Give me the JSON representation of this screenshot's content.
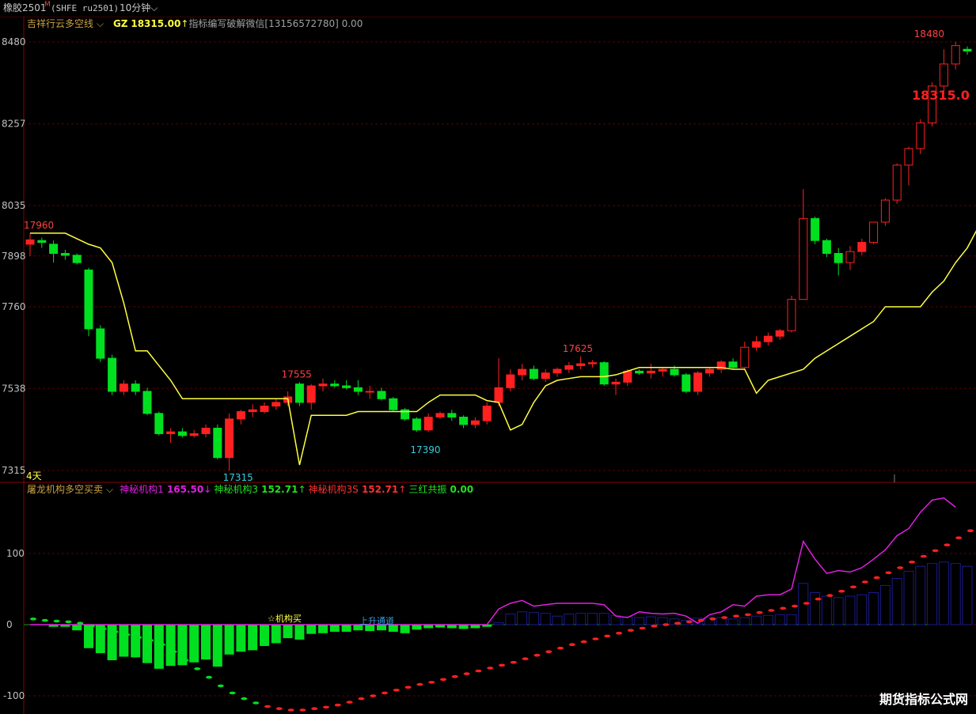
{
  "header": {
    "instrument": "橡胶2501",
    "superscript": "M",
    "code": "(SHFE ru2501)",
    "period": "10分钟"
  },
  "indicator1": {
    "name": "吉祥行云多空线",
    "gz_label": "GZ",
    "gz_value": "18315.00",
    "note": "指标编写破解微信[13156572780]",
    "note_value": "0.00"
  },
  "indicator2": {
    "name": "屠龙机构多空买卖",
    "items": [
      {
        "label": "神秘机构1",
        "value": "165.50",
        "arrow": "↓",
        "color": "#e020e0"
      },
      {
        "label": "神秘机构3",
        "value": "152.71",
        "arrow": "↑",
        "color": "#20e020"
      },
      {
        "label": "神秘机构3S",
        "value": "152.71",
        "arrow": "↑",
        "color": "#ff3030"
      },
      {
        "label": "三红共振",
        "value": "0.00",
        "arrow": "",
        "color": "#20e020"
      }
    ]
  },
  "annotations": {
    "days": "4天",
    "buy_signal": "☆机构买",
    "uptrend": "上升通道",
    "last_price": "18315.0"
  },
  "watermark": "期货指标公式网",
  "colors": {
    "up": "#ff2020",
    "down": "#00e020",
    "line": "#ffff40",
    "osc": "#e020e0",
    "bar_pos": "#1a1a8a",
    "grid": "#5a0000"
  },
  "chart_data": [
    {
      "type": "candlestick",
      "title": "吉祥行云多空线",
      "y_ticks": [
        {
          "label": "8480",
          "value": 18480
        },
        {
          "label": "8257",
          "value": 18257
        },
        {
          "label": "8035",
          "value": 18035
        },
        {
          "label": "7898",
          "value": 17898
        },
        {
          "label": "7760",
          "value": 17760
        },
        {
          "label": "7538",
          "value": 17538
        },
        {
          "label": "7315",
          "value": 17315
        }
      ],
      "ylim": [
        17315,
        18480
      ],
      "labels": [
        {
          "text": "17960",
          "i": 0,
          "value": 17960,
          "pos": "high"
        },
        {
          "text": "17555",
          "i": 22,
          "value": 17555,
          "pos": "high"
        },
        {
          "text": "17625",
          "i": 46,
          "value": 17625,
          "pos": "high"
        },
        {
          "text": "17315",
          "i": 17,
          "value": 17315,
          "pos": "low"
        },
        {
          "text": "17390",
          "i": 33,
          "value": 17390,
          "pos": "low"
        },
        {
          "text": "18480",
          "i": 76,
          "value": 18480,
          "pos": "high"
        }
      ],
      "ohlc": [
        [
          17930,
          17960,
          17898,
          17942
        ],
        [
          17940,
          17948,
          17920,
          17935
        ],
        [
          17930,
          17940,
          17880,
          17905
        ],
        [
          17905,
          17915,
          17888,
          17900
        ],
        [
          17900,
          17905,
          17875,
          17880
        ],
        [
          17860,
          17866,
          17680,
          17700
        ],
        [
          17700,
          17710,
          17610,
          17620
        ],
        [
          17620,
          17630,
          17520,
          17530
        ],
        [
          17530,
          17560,
          17520,
          17550
        ],
        [
          17550,
          17560,
          17520,
          17530
        ],
        [
          17530,
          17540,
          17465,
          17470
        ],
        [
          17470,
          17475,
          17410,
          17415
        ],
        [
          17415,
          17430,
          17390,
          17420
        ],
        [
          17420,
          17430,
          17405,
          17410
        ],
        [
          17410,
          17425,
          17405,
          17415
        ],
        [
          17415,
          17440,
          17405,
          17430
        ],
        [
          17430,
          17440,
          17345,
          17350
        ],
        [
          17350,
          17470,
          17315,
          17455
        ],
        [
          17455,
          17480,
          17440,
          17475
        ],
        [
          17475,
          17495,
          17460,
          17480
        ],
        [
          17475,
          17500,
          17470,
          17490
        ],
        [
          17490,
          17510,
          17480,
          17500
        ],
        [
          17500,
          17530,
          17490,
          17515
        ],
        [
          17550,
          17555,
          17490,
          17500
        ],
        [
          17500,
          17550,
          17480,
          17545
        ],
        [
          17545,
          17565,
          17530,
          17550
        ],
        [
          17550,
          17560,
          17540,
          17545
        ],
        [
          17545,
          17560,
          17535,
          17540
        ],
        [
          17540,
          17560,
          17520,
          17530
        ],
        [
          17530,
          17545,
          17510,
          17530
        ],
        [
          17530,
          17540,
          17505,
          17510
        ],
        [
          17510,
          17515,
          17475,
          17480
        ],
        [
          17480,
          17485,
          17450,
          17455
        ],
        [
          17455,
          17460,
          17420,
          17425
        ],
        [
          17425,
          17470,
          17420,
          17460
        ],
        [
          17460,
          17475,
          17455,
          17470
        ],
        [
          17470,
          17480,
          17450,
          17460
        ],
        [
          17460,
          17465,
          17430,
          17440
        ],
        [
          17440,
          17460,
          17430,
          17450
        ],
        [
          17450,
          17500,
          17440,
          17490
        ],
        [
          17500,
          17620,
          17490,
          17540
        ],
        [
          17540,
          17590,
          17530,
          17575
        ],
        [
          17575,
          17605,
          17560,
          17590
        ],
        [
          17590,
          17600,
          17560,
          17565
        ],
        [
          17565,
          17590,
          17555,
          17580
        ],
        [
          17580,
          17595,
          17570,
          17590
        ],
        [
          17590,
          17610,
          17580,
          17600
        ],
        [
          17600,
          17625,
          17590,
          17605
        ],
        [
          17605,
          17615,
          17595,
          17608
        ],
        [
          17608,
          17612,
          17545,
          17550
        ],
        [
          17550,
          17565,
          17520,
          17555
        ],
        [
          17555,
          17590,
          17545,
          17585
        ],
        [
          17585,
          17590,
          17575,
          17580
        ],
        [
          17580,
          17605,
          17565,
          17585
        ],
        [
          17585,
          17595,
          17570,
          17590
        ],
        [
          17590,
          17600,
          17570,
          17575
        ],
        [
          17575,
          17580,
          17525,
          17530
        ],
        [
          17530,
          17585,
          17520,
          17580
        ],
        [
          17580,
          17595,
          17570,
          17590
        ],
        [
          17590,
          17615,
          17580,
          17610
        ],
        [
          17610,
          17620,
          17590,
          17595
        ],
        [
          17595,
          17665,
          17590,
          17650
        ],
        [
          17650,
          17680,
          17640,
          17665
        ],
        [
          17665,
          17690,
          17655,
          17680
        ],
        [
          17680,
          17700,
          17670,
          17695
        ],
        [
          17695,
          17790,
          17690,
          17780
        ],
        [
          17780,
          18080,
          17780,
          18000
        ],
        [
          18000,
          18005,
          17930,
          17940
        ],
        [
          17940,
          17945,
          17895,
          17905
        ],
        [
          17905,
          17920,
          17845,
          17880
        ],
        [
          17880,
          17925,
          17860,
          17910
        ],
        [
          17910,
          17945,
          17900,
          17935
        ],
        [
          17935,
          17990,
          17930,
          17990
        ],
        [
          17990,
          18055,
          17980,
          18050
        ],
        [
          18050,
          18150,
          18040,
          18145
        ],
        [
          18145,
          18195,
          18090,
          18190
        ],
        [
          18190,
          18270,
          18175,
          18260
        ],
        [
          18260,
          18370,
          18250,
          18360
        ],
        [
          18360,
          18460,
          18340,
          18420
        ],
        [
          18420,
          18480,
          18405,
          18470
        ],
        [
          18460,
          18468,
          18445,
          18455
        ]
      ],
      "line": [
        17960,
        17960,
        17960,
        17960,
        17945,
        17930,
        17920,
        17880,
        17770,
        17640,
        17640,
        17600,
        17560,
        17510,
        17510,
        17510,
        17510,
        17510,
        17510,
        17510,
        17510,
        17510,
        17510,
        17330,
        17465,
        17465,
        17465,
        17465,
        17475,
        17475,
        17475,
        17475,
        17475,
        17475,
        17500,
        17520,
        17520,
        17520,
        17520,
        17505,
        17500,
        17425,
        17440,
        17500,
        17545,
        17560,
        17565,
        17570,
        17570,
        17570,
        17575,
        17585,
        17595,
        17595,
        17595,
        17595,
        17595,
        17595,
        17595,
        17595,
        17590,
        17590,
        17525,
        17560,
        17570,
        17580,
        17590,
        17620,
        17640,
        17660,
        17680,
        17700,
        17720,
        17760,
        17760,
        17760,
        17760,
        17800,
        17830,
        17880,
        17920,
        17980,
        18120,
        18180,
        18250,
        18310
      ],
      "series_name": "GZ"
    },
    {
      "type": "bar",
      "title": "屠龙机构多空买卖",
      "y_ticks": [
        {
          "label": "100",
          "value": 100
        },
        {
          "label": "0",
          "value": 0
        },
        {
          "label": "-100",
          "value": -100
        }
      ],
      "ylim": [
        -120,
        185
      ],
      "bars": [
        0,
        0,
        -3,
        -3,
        -8,
        -33,
        -40,
        -50,
        -45,
        -46,
        -54,
        -62,
        -58,
        -57,
        -53,
        -49,
        -59,
        -42,
        -38,
        -36,
        -30,
        -26,
        -19,
        -21,
        -13,
        -12,
        -10,
        -10,
        -8,
        -9,
        -8,
        -10,
        -12,
        -7,
        -5,
        -4,
        -5,
        -6,
        -5,
        -3,
        3,
        15,
        18,
        17,
        16,
        12,
        15,
        16,
        16,
        16,
        13,
        11,
        10,
        11,
        10,
        8,
        6,
        9,
        10,
        10,
        8,
        10,
        12,
        13,
        14,
        14,
        58,
        45,
        40,
        38,
        40,
        42,
        45,
        55,
        65,
        75,
        82,
        86,
        88,
        86,
        82
      ],
      "line": [
        0,
        0,
        0,
        0,
        0,
        0,
        0,
        0,
        0,
        0,
        0,
        0,
        0,
        0,
        0,
        0,
        0,
        0,
        0,
        0,
        0,
        0,
        0,
        0,
        0,
        0,
        0,
        0,
        0,
        0,
        0,
        0,
        0,
        0,
        0,
        0,
        0,
        0,
        0,
        0,
        22,
        30,
        34,
        26,
        28,
        30,
        30,
        30,
        30,
        28,
        12,
        10,
        18,
        16,
        15,
        16,
        12,
        2,
        14,
        18,
        28,
        26,
        40,
        42,
        42,
        50,
        117,
        92,
        72,
        76,
        74,
        80,
        92,
        105,
        125,
        135,
        158,
        175,
        178,
        165
      ],
      "dots": [
        8,
        6,
        5,
        4,
        2,
        -2,
        -6,
        -10,
        -14,
        -18,
        -22,
        -28,
        -38,
        -50,
        -62,
        -74,
        -86,
        -96,
        -104,
        -110,
        -115,
        -118,
        -120,
        -120,
        -118,
        -116,
        -113,
        -109,
        -104,
        -100,
        -96,
        -92,
        -88,
        -84,
        -81,
        -77,
        -73,
        -69,
        -65,
        -61,
        -57,
        -53,
        -48,
        -43,
        -38,
        -33,
        -28,
        -24,
        -20,
        -16,
        -12,
        -8,
        -5,
        -2,
        0,
        2,
        4,
        6,
        8,
        10,
        12,
        14,
        17,
        20,
        23,
        26,
        30,
        36,
        41,
        47,
        53,
        60,
        66,
        73,
        80,
        88,
        96,
        104,
        112,
        122,
        132,
        140,
        152
      ],
      "annotations": [
        "☆机构买",
        "上升通道"
      ]
    }
  ]
}
